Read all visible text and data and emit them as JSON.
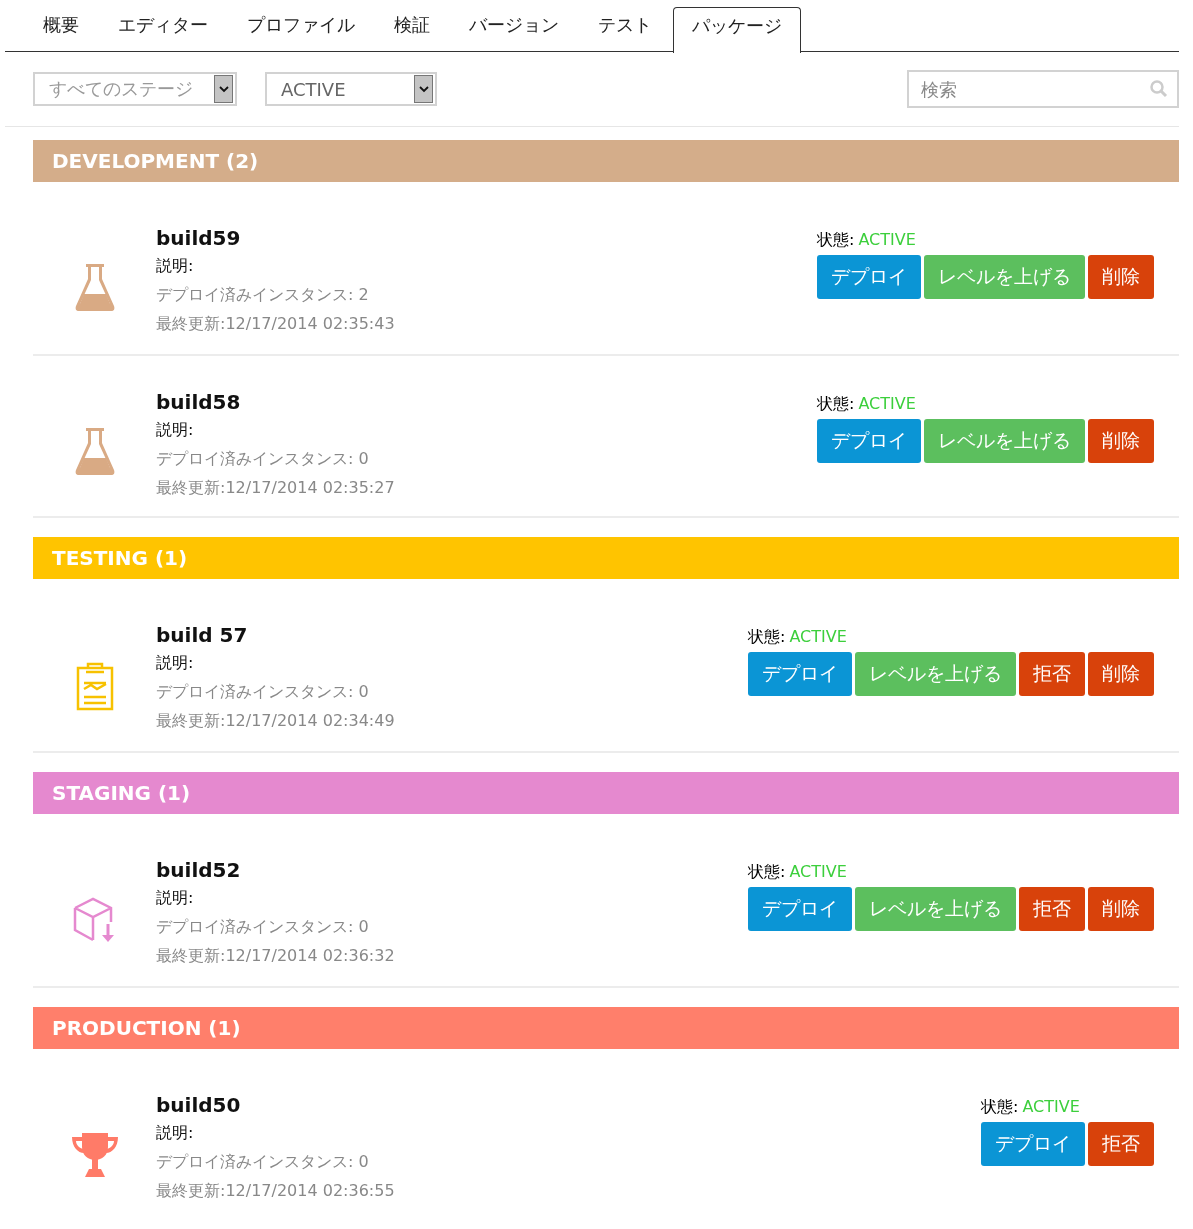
{
  "tabs": [
    {
      "label": "概要",
      "selected": false
    },
    {
      "label": "エディター",
      "selected": false
    },
    {
      "label": "プロファイル",
      "selected": false
    },
    {
      "label": "検証",
      "selected": false
    },
    {
      "label": "バージョン",
      "selected": false
    },
    {
      "label": "テスト",
      "selected": false
    },
    {
      "label": "パッケージ",
      "selected": true
    }
  ],
  "filters": {
    "stage": "すべてのステージ",
    "status": "ACTIVE",
    "search": {
      "placeholder": "検索"
    }
  },
  "sections": [
    {
      "title": "DEVELOPMENT (2)",
      "kind": "development",
      "color": "#d4ad8a",
      "builds": [
        {
          "name": "build59",
          "description": "説明:",
          "instances": "デプロイ済みインスタンス: 2",
          "updated": "最終更新:12/17/2014 02:35:43",
          "status_label": "状態:",
          "status": "ACTIVE",
          "buttons": [
            {
              "label": "デプロイ",
              "kind": "deploy"
            },
            {
              "label": "レベルを上げる",
              "kind": "promote"
            },
            {
              "label": "削除",
              "kind": "delete"
            }
          ]
        },
        {
          "name": "build58",
          "description": "説明:",
          "instances": "デプロイ済みインスタンス: 0",
          "updated": "最終更新:12/17/2014 02:35:27",
          "status_label": "状態:",
          "status": "ACTIVE",
          "buttons": [
            {
              "label": "デプロイ",
              "kind": "deploy"
            },
            {
              "label": "レベルを上げる",
              "kind": "promote"
            },
            {
              "label": "削除",
              "kind": "delete"
            }
          ]
        }
      ]
    },
    {
      "title": "TESTING (1)",
      "kind": "testing",
      "color": "#ffc400",
      "builds": [
        {
          "name": "build 57",
          "description": "説明:",
          "instances": "デプロイ済みインスタンス: 0",
          "updated": "最終更新:12/17/2014 02:34:49",
          "status_label": "状態:",
          "status": "ACTIVE",
          "buttons": [
            {
              "label": "デプロイ",
              "kind": "deploy"
            },
            {
              "label": "レベルを上げる",
              "kind": "promote"
            },
            {
              "label": "拒否",
              "kind": "reject"
            },
            {
              "label": "削除",
              "kind": "delete"
            }
          ]
        }
      ]
    },
    {
      "title": "STAGING (1)",
      "kind": "staging",
      "color": "#e589cf",
      "builds": [
        {
          "name": "build52",
          "description": "説明:",
          "instances": "デプロイ済みインスタンス: 0",
          "updated": "最終更新:12/17/2014 02:36:32",
          "status_label": "状態:",
          "status": "ACTIVE",
          "buttons": [
            {
              "label": "デプロイ",
              "kind": "deploy"
            },
            {
              "label": "レベルを上げる",
              "kind": "promote"
            },
            {
              "label": "拒否",
              "kind": "reject"
            },
            {
              "label": "削除",
              "kind": "delete"
            }
          ]
        }
      ]
    },
    {
      "title": "PRODUCTION (1)",
      "kind": "production",
      "color": "#ff7f6b",
      "builds": [
        {
          "name": "build50",
          "description": "説明:",
          "instances": "デプロイ済みインスタンス: 0",
          "updated": "最終更新:12/17/2014 02:36:55",
          "status_label": "状態:",
          "status": "ACTIVE",
          "buttons": [
            {
              "label": "デプロイ",
              "kind": "deploy"
            },
            {
              "label": "拒否",
              "kind": "reject"
            }
          ]
        }
      ]
    }
  ]
}
